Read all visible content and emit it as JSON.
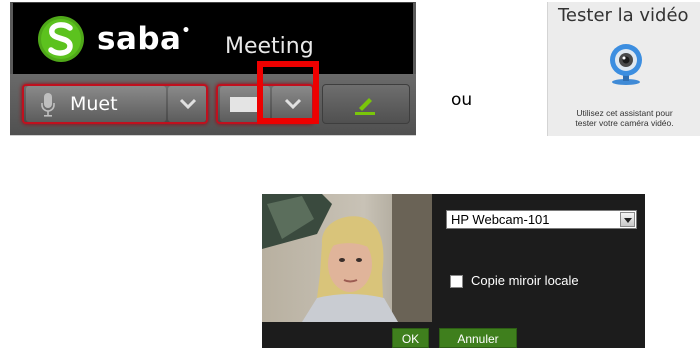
{
  "saba": {
    "brand": "saba",
    "product": "Meeting",
    "audio": {
      "label": "Muet"
    }
  },
  "connector": "ou",
  "test_video": {
    "title": "Tester la vidéo",
    "description": "Utilisez cet assistant pour\ntester votre caméra vidéo."
  },
  "webcam_dialog": {
    "camera": "HP Webcam-101",
    "mirror_label": "Copie miroir locale",
    "mirror_checked": false,
    "ok_label": "OK",
    "cancel_label": "Annuler"
  },
  "colors": {
    "highlight": "#ee0000",
    "active_red": "#c0101e",
    "pen_green": "#7ac60a",
    "dialog_button": "#3f7f1d"
  }
}
